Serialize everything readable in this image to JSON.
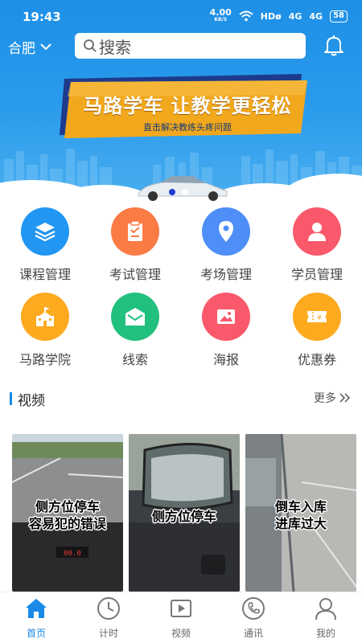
{
  "status": {
    "time": "19:43",
    "speed": "4.00",
    "speed_unit": "KB/S",
    "hd": "HDø",
    "sig1": "4G",
    "sig2": "4G",
    "battery": "58"
  },
  "header": {
    "city": "合肥",
    "search_placeholder": "搜索"
  },
  "banner": {
    "title": "马路学车 让教学更轻松",
    "subtitle": "直击解决教练头疼问题",
    "slide_count": 2,
    "active_slide": 1
  },
  "features": [
    {
      "label": "课程管理",
      "icon": "layers-icon",
      "color": "#2196f3"
    },
    {
      "label": "考试管理",
      "icon": "clipboard-icon",
      "color": "#fb7b45"
    },
    {
      "label": "考场管理",
      "icon": "location-pin-icon",
      "color": "#4d8ef7"
    },
    {
      "label": "学员管理",
      "icon": "user-icon",
      "color": "#f9596b"
    },
    {
      "label": "马路学院",
      "icon": "school-icon",
      "color": "#fdaa1f"
    },
    {
      "label": "线索",
      "icon": "mail-icon",
      "color": "#22c07e"
    },
    {
      "label": "海报",
      "icon": "picture-icon",
      "color": "#f9596b"
    },
    {
      "label": "优惠券",
      "icon": "coupon-icon",
      "color": "#fdaa1f"
    }
  ],
  "video_section": {
    "title": "视频",
    "more": "更多"
  },
  "videos": [
    {
      "caption_line1": "侧方位停车",
      "caption_line2": "容易犯的错误",
      "dashboard_reading": "00.0"
    },
    {
      "caption_line1": "侧方位停车",
      "caption_line2": ""
    },
    {
      "caption_line1": "倒车入库",
      "caption_line2": "进库过大"
    }
  ],
  "nav": [
    {
      "label": "首页",
      "icon": "home-icon",
      "active": true
    },
    {
      "label": "计时",
      "icon": "clock-icon",
      "active": false
    },
    {
      "label": "视频",
      "icon": "video-play-icon",
      "active": false
    },
    {
      "label": "通讯",
      "icon": "phone-icon",
      "active": false
    },
    {
      "label": "我的",
      "icon": "profile-icon",
      "active": false
    }
  ],
  "colors": {
    "brand_blue": "#1a8ae6",
    "ribbon_gold": "#f2a81d",
    "ribbon_navy": "#1d3a8c"
  }
}
